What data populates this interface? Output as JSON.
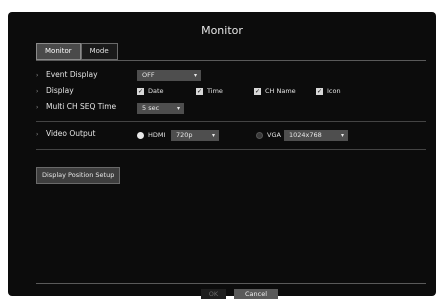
{
  "window": {
    "title": "Monitor"
  },
  "tabs": [
    {
      "label": "Monitor",
      "active": true
    },
    {
      "label": "Mode",
      "active": false
    }
  ],
  "settings": {
    "event_display": {
      "label": "Event Display",
      "value": "OFF"
    },
    "display": {
      "label": "Display",
      "options": [
        {
          "label": "Date",
          "checked": true
        },
        {
          "label": "Time",
          "checked": true
        },
        {
          "label": "CH Name",
          "checked": true
        },
        {
          "label": "Icon",
          "checked": true
        }
      ]
    },
    "multi_ch_seq_time": {
      "label": "Multi CH SEQ Time",
      "value": "5 sec"
    },
    "video_output": {
      "label": "Video Output",
      "hdmi": {
        "label": "HDMI",
        "selected": true,
        "resolution": "720p"
      },
      "vga": {
        "label": "VGA",
        "selected": false,
        "resolution": "1024x768"
      }
    }
  },
  "buttons": {
    "display_position_setup": "Display Position Setup",
    "ok": "OK",
    "cancel": "Cancel"
  },
  "icons": {
    "dropdown": "chevron-down-icon",
    "checkbox": "check-icon",
    "bullet": "chevron-right-icon"
  },
  "colors": {
    "background": "#0c0c0c",
    "active_tab": "#4a4a4a",
    "dropdown": "#4e4e4e",
    "cancel_button": "#5a5a5a"
  }
}
